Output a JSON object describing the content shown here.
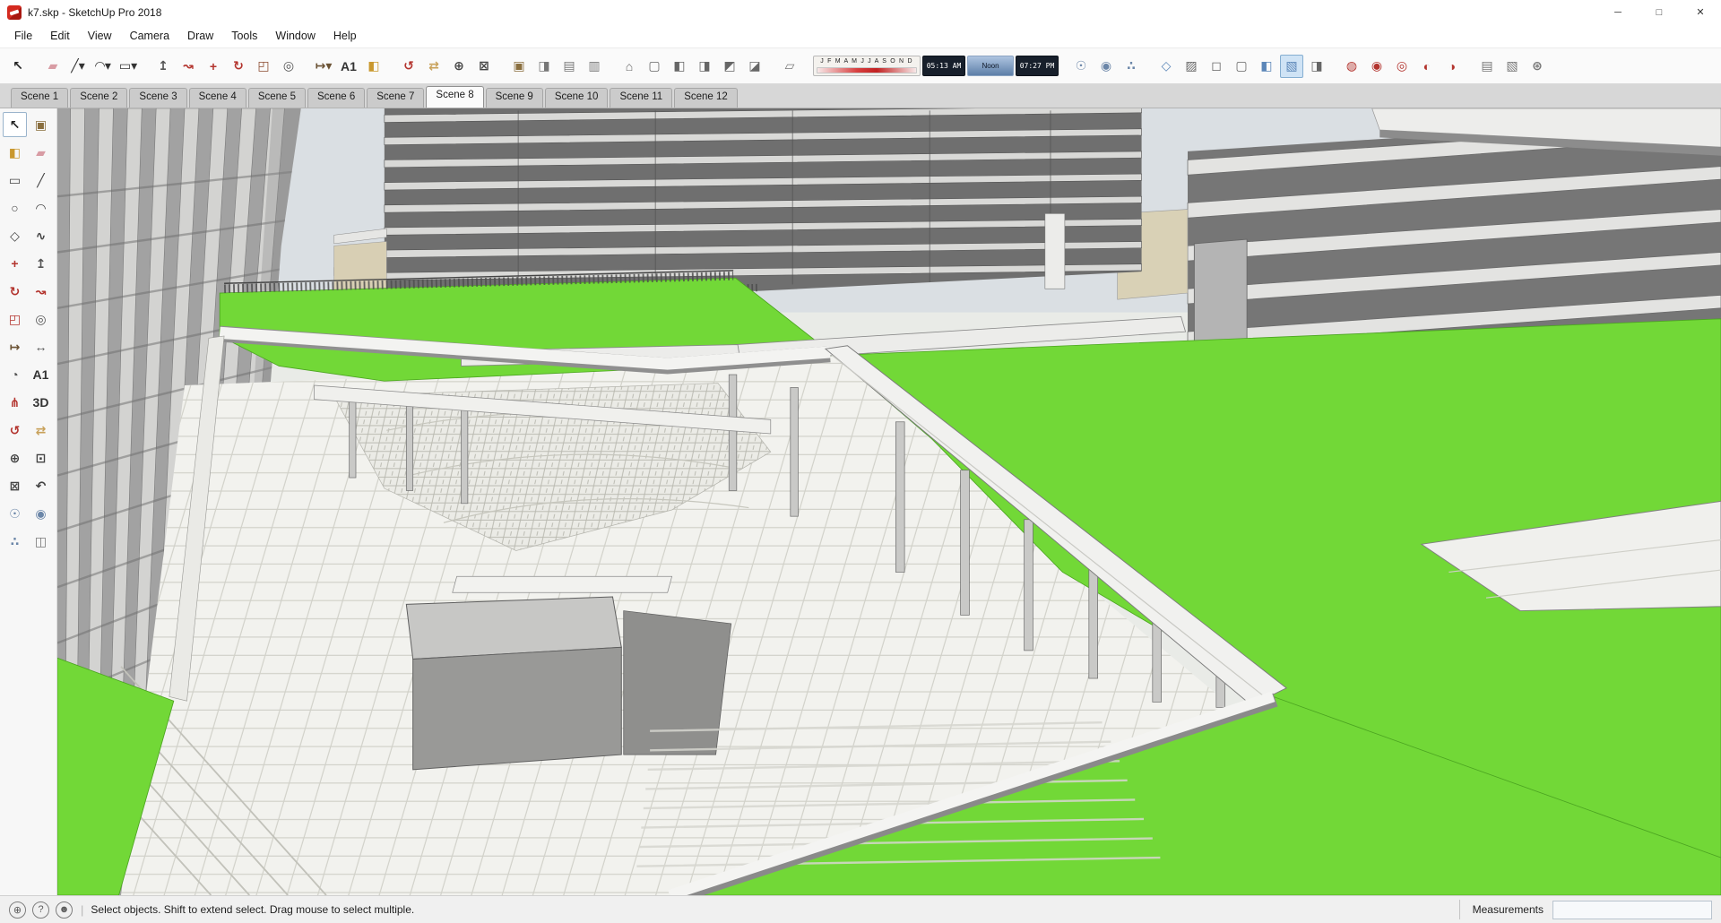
{
  "window": {
    "title": "k7.skp - SketchUp Pro 2018",
    "controls": {
      "minimize": "─",
      "maximize": "□",
      "close": "✕"
    }
  },
  "menubar": {
    "items": [
      {
        "name": "file",
        "label": "File"
      },
      {
        "name": "edit",
        "label": "Edit"
      },
      {
        "name": "view",
        "label": "View"
      },
      {
        "name": "camera",
        "label": "Camera"
      },
      {
        "name": "draw",
        "label": "Draw"
      },
      {
        "name": "tools",
        "label": "Tools"
      },
      {
        "name": "window",
        "label": "Window"
      },
      {
        "name": "help",
        "label": "Help"
      }
    ]
  },
  "toolbar": {
    "icons_left": [
      {
        "name": "select",
        "glyph": "↖",
        "color": "#222222"
      },
      {
        "name": "eraser",
        "glyph": "▰",
        "color": "#d89ca4",
        "gap": true
      },
      {
        "name": "line",
        "glyph": "╱▾",
        "color": "#333333"
      },
      {
        "name": "arc",
        "glyph": "◠▾",
        "color": "#333333"
      },
      {
        "name": "shapes",
        "glyph": "▭▾",
        "color": "#333333"
      },
      {
        "name": "push-pull",
        "glyph": "↥",
        "color": "#555555",
        "gap": true
      },
      {
        "name": "follow-me",
        "glyph": "↝",
        "color": "#b3342e"
      },
      {
        "name": "move",
        "glyph": "+",
        "color": "#b3342e"
      },
      {
        "name": "rotate",
        "glyph": "↻",
        "color": "#b3342e"
      },
      {
        "name": "scale",
        "glyph": "◰",
        "color": "#8a4a2e"
      },
      {
        "name": "offset",
        "glyph": "◎",
        "color": "#555555"
      },
      {
        "name": "tape-measure",
        "glyph": "↦▾",
        "color": "#6b5335",
        "gap": true
      },
      {
        "name": "text",
        "glyph": "A1",
        "color": "#333333"
      },
      {
        "name": "paint-bucket",
        "glyph": "◧",
        "color": "#c9982e"
      },
      {
        "name": "orbit",
        "glyph": "↺",
        "color": "#b3342e",
        "gap": true
      },
      {
        "name": "pan",
        "glyph": "⇄",
        "color": "#c8a15a"
      },
      {
        "name": "zoom",
        "glyph": "⊕",
        "color": "#444444"
      },
      {
        "name": "zoom-extents",
        "glyph": "⊠",
        "color": "#444444"
      },
      {
        "name": "make-component",
        "glyph": "▣",
        "color": "#8a6f3f",
        "gap": true
      },
      {
        "name": "components",
        "glyph": "◨",
        "color": "#777777"
      },
      {
        "name": "materials",
        "glyph": "▤",
        "color": "#777777"
      },
      {
        "name": "styles",
        "glyph": "▥",
        "color": "#777777"
      },
      {
        "name": "view-iso",
        "glyph": "⌂",
        "color": "#666666",
        "gap": true
      },
      {
        "name": "view-top",
        "glyph": "▢",
        "color": "#666666"
      },
      {
        "name": "view-front",
        "glyph": "◧",
        "color": "#666666"
      },
      {
        "name": "view-right",
        "glyph": "◨",
        "color": "#666666"
      },
      {
        "name": "view-back",
        "glyph": "◩",
        "color": "#666666"
      },
      {
        "name": "view-left",
        "glyph": "◪",
        "color": "#666666"
      },
      {
        "name": "shadows-toggle",
        "glyph": "▱",
        "color": "#777777",
        "gap": true
      }
    ],
    "shadow": {
      "months": "J F M A M J J A S O N D",
      "time_start": "05:13 AM",
      "time_noon": "Noon",
      "time_end": "07:27 PM"
    },
    "icons_right": [
      {
        "name": "position-camera",
        "glyph": "☉",
        "color": "#6b86a8",
        "gap": true
      },
      {
        "name": "look-around",
        "glyph": "◉",
        "color": "#6b86a8"
      },
      {
        "name": "walk",
        "glyph": "∴",
        "color": "#6b86a8"
      },
      {
        "name": "x-ray",
        "glyph": "◇",
        "color": "#5b86b8",
        "gap": true
      },
      {
        "name": "back-edges",
        "glyph": "▨",
        "color": "#666666"
      },
      {
        "name": "wireframe",
        "glyph": "◻",
        "color": "#666666"
      },
      {
        "name": "hidden-line",
        "glyph": "▢",
        "color": "#666666"
      },
      {
        "name": "shaded",
        "glyph": "◧",
        "color": "#5b86b8"
      },
      {
        "name": "shaded-with-textures",
        "glyph": "▧",
        "color": "#5b86b8",
        "pressed": true
      },
      {
        "name": "monochrome",
        "glyph": "◨",
        "color": "#666666"
      },
      {
        "name": "outer-shell",
        "glyph": "◍",
        "color": "#b3342e",
        "gap": true
      },
      {
        "name": "intersect",
        "glyph": "◉",
        "color": "#b3342e"
      },
      {
        "name": "union",
        "glyph": "◎",
        "color": "#b3342e"
      },
      {
        "name": "subtract",
        "glyph": "◐",
        "color": "#b3342e"
      },
      {
        "name": "trim",
        "glyph": "◑",
        "color": "#b3342e"
      },
      {
        "name": "model-info",
        "glyph": "▤",
        "color": "#777777",
        "gap": true
      },
      {
        "name": "instructor",
        "glyph": "▧",
        "color": "#777777"
      },
      {
        "name": "preferences",
        "glyph": "⊛",
        "color": "#777777"
      }
    ]
  },
  "scene_tabs": {
    "tabs": [
      {
        "name": "1",
        "label": "Scene 1"
      },
      {
        "name": "2",
        "label": "Scene 2"
      },
      {
        "name": "3",
        "label": "Scene 3"
      },
      {
        "name": "4",
        "label": "Scene 4"
      },
      {
        "name": "5",
        "label": "Scene 5"
      },
      {
        "name": "6",
        "label": "Scene 6"
      },
      {
        "name": "7",
        "label": "Scene 7"
      },
      {
        "name": "8",
        "label": "Scene 8",
        "pressed": true
      },
      {
        "name": "9",
        "label": "Scene 9"
      },
      {
        "name": "10",
        "label": "Scene 10"
      },
      {
        "name": "11",
        "label": "Scene 11"
      },
      {
        "name": "12",
        "label": "Scene 12"
      }
    ]
  },
  "tool_palette": {
    "tools": [
      {
        "name": "select",
        "glyph": "↖",
        "color": "#222222",
        "pressed": true
      },
      {
        "name": "make-component",
        "glyph": "▣",
        "color": "#8a6f3f"
      },
      {
        "name": "paint-bucket",
        "glyph": "◧",
        "color": "#c9982e"
      },
      {
        "name": "eraser",
        "glyph": "▰",
        "color": "#d89ca4"
      },
      {
        "name": "rectangle",
        "glyph": "▭",
        "color": "#444444"
      },
      {
        "name": "line",
        "glyph": "╱",
        "color": "#444444"
      },
      {
        "name": "circle",
        "glyph": "○",
        "color": "#444444"
      },
      {
        "name": "arc",
        "glyph": "◠",
        "color": "#444444"
      },
      {
        "name": "polygon",
        "glyph": "◇",
        "color": "#444444"
      },
      {
        "name": "freehand",
        "glyph": "∿",
        "color": "#444444"
      },
      {
        "name": "move",
        "glyph": "+",
        "color": "#b3342e"
      },
      {
        "name": "push-pull",
        "glyph": "↥",
        "color": "#555555"
      },
      {
        "name": "rotate",
        "glyph": "↻",
        "color": "#b3342e"
      },
      {
        "name": "follow-me",
        "glyph": "↝",
        "color": "#b3342e"
      },
      {
        "name": "scale",
        "glyph": "◰",
        "color": "#b3342e"
      },
      {
        "name": "offset",
        "glyph": "◎",
        "color": "#555555"
      },
      {
        "name": "tape-measure",
        "glyph": "↦",
        "color": "#6b5335"
      },
      {
        "name": "dimension",
        "glyph": "↔",
        "color": "#555555"
      },
      {
        "name": "protractor",
        "glyph": "◔",
        "color": "#555555"
      },
      {
        "name": "text",
        "glyph": "A1",
        "color": "#333333"
      },
      {
        "name": "axes",
        "glyph": "⋔",
        "color": "#b3342e"
      },
      {
        "name": "3d-text",
        "glyph": "3D",
        "color": "#333333"
      },
      {
        "name": "orbit",
        "glyph": "↺",
        "color": "#b3342e"
      },
      {
        "name": "pan",
        "glyph": "⇄",
        "color": "#c8a15a"
      },
      {
        "name": "zoom",
        "glyph": "⊕",
        "color": "#444444"
      },
      {
        "name": "zoom-window",
        "glyph": "⊡",
        "color": "#444444"
      },
      {
        "name": "zoom-extents",
        "glyph": "⊠",
        "color": "#444444"
      },
      {
        "name": "previous",
        "glyph": "↶",
        "color": "#444444"
      },
      {
        "name": "position-camera",
        "glyph": "☉",
        "color": "#6b86a8"
      },
      {
        "name": "look-around",
        "glyph": "◉",
        "color": "#6b86a8"
      },
      {
        "name": "walk",
        "glyph": "∴",
        "color": "#6b86a8"
      },
      {
        "name": "section-plane",
        "glyph": "◫",
        "color": "#777777"
      }
    ]
  },
  "viewport": {
    "colors": {
      "sky": "#dadfe3",
      "grass": "#72d837",
      "building_dark": "#6f6f6f",
      "slab_light": "#d9d9d7",
      "paving": "#f2f2ee",
      "beige_wall": "#d8cfb4"
    }
  },
  "statusbar": {
    "icons": [
      {
        "name": "geolocation",
        "glyph": "⊕"
      },
      {
        "name": "help",
        "glyph": "?"
      },
      {
        "name": "user",
        "glyph": "☻"
      }
    ],
    "message": "Select objects. Shift to extend select. Drag mouse to select multiple.",
    "measurements_label": "Measurements",
    "measurements_value": ""
  }
}
